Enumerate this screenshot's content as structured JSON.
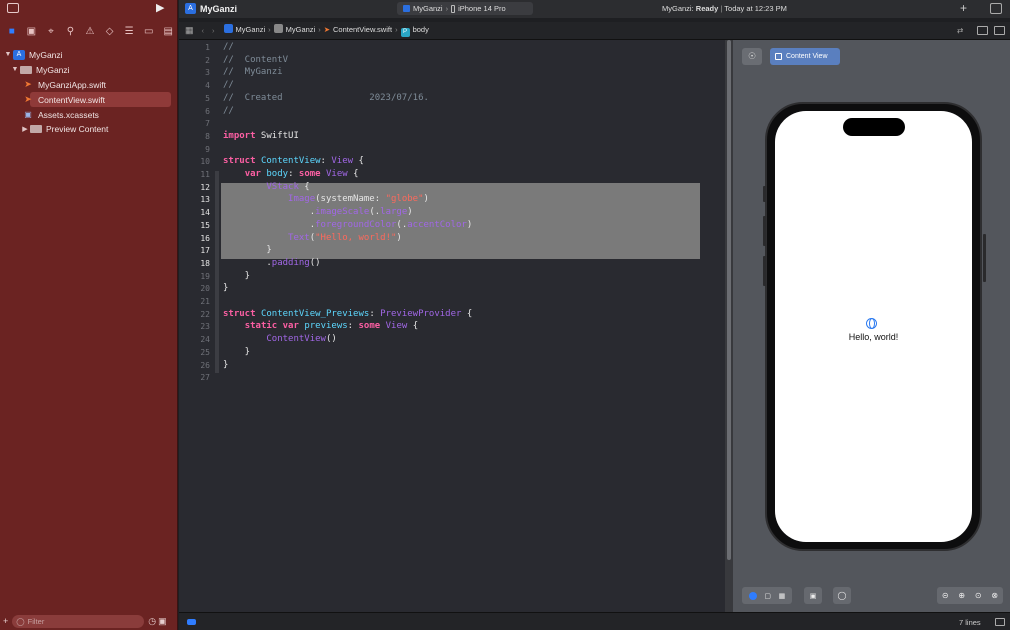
{
  "toolbar": {
    "project_title": "MyGanzi",
    "scheme_target": "MyGanzi",
    "scheme_device": "iPhone 14 Pro",
    "status_project": "MyGanzi:",
    "status_state": "Ready",
    "status_time": "Today at 12:23 PM",
    "plus": "+"
  },
  "sidebar": {
    "filter_placeholder": "Filter",
    "tree": [
      {
        "label": "MyGanzi",
        "kind": "app",
        "depth": 0,
        "open": true
      },
      {
        "label": "MyGanzi",
        "kind": "folder",
        "depth": 1,
        "open": true
      },
      {
        "label": "MyGanziApp.swift",
        "kind": "swift",
        "depth": 2
      },
      {
        "label": "ContentView.swift",
        "kind": "swift",
        "depth": 2,
        "selected": true
      },
      {
        "label": "Assets.xcassets",
        "kind": "assets",
        "depth": 2
      },
      {
        "label": "Preview Content",
        "kind": "folder",
        "depth": 2,
        "open": false
      }
    ]
  },
  "jumpbar": {
    "crumbs": [
      "MyGanzi",
      "MyGanzi",
      "ContentView.swift",
      "body"
    ]
  },
  "editor": {
    "lines": [
      [
        [
          "cm",
          "//"
        ]
      ],
      [
        [
          "cm",
          "//  ContentV"
        ]
      ],
      [
        [
          "cm",
          "//  MyGanzi"
        ]
      ],
      [
        [
          "cm",
          "//"
        ]
      ],
      [
        [
          "cm",
          "//  Created                2023/07/16."
        ]
      ],
      [
        [
          "cm",
          "//"
        ]
      ],
      [],
      [
        [
          "kw",
          "import"
        ],
        [
          "pl",
          " SwiftUI"
        ]
      ],
      [],
      [
        [
          "kw",
          "struct"
        ],
        [
          "pl",
          " "
        ],
        [
          "ty",
          "ContentView"
        ],
        [
          "pl",
          ": "
        ],
        [
          "fn",
          "View"
        ],
        [
          "pl",
          " {"
        ]
      ],
      [
        [
          "pl",
          "    "
        ],
        [
          "kw",
          "var"
        ],
        [
          "pl",
          " "
        ],
        [
          "ty",
          "body"
        ],
        [
          "pl",
          ": "
        ],
        [
          "kw",
          "some"
        ],
        [
          "pl",
          " "
        ],
        [
          "fn",
          "View"
        ],
        [
          "pl",
          " {"
        ]
      ],
      [
        [
          "pl",
          "        "
        ],
        [
          "fn",
          "VStack"
        ],
        [
          "pl",
          " {"
        ]
      ],
      [
        [
          "pl",
          "            "
        ],
        [
          "fn",
          "Image"
        ],
        [
          "pl",
          "(systemName: "
        ],
        [
          "st",
          "\"globe\""
        ],
        [
          "pl",
          ")"
        ]
      ],
      [
        [
          "pl",
          "                ."
        ],
        [
          "fn",
          "imageScale"
        ],
        [
          "pl",
          "(."
        ],
        [
          "fn",
          "large"
        ],
        [
          "pl",
          ")"
        ]
      ],
      [
        [
          "pl",
          "                ."
        ],
        [
          "fn",
          "foregroundColor"
        ],
        [
          "pl",
          "(."
        ],
        [
          "fn",
          "accentColor"
        ],
        [
          "pl",
          ")"
        ]
      ],
      [
        [
          "pl",
          "            "
        ],
        [
          "fn",
          "Text"
        ],
        [
          "pl",
          "("
        ],
        [
          "st",
          "\"Hello, world!\""
        ],
        [
          "pl",
          ")"
        ]
      ],
      [
        [
          "pl",
          "        }"
        ]
      ],
      [
        [
          "pl",
          "        ."
        ],
        [
          "fn",
          "padding"
        ],
        [
          "pl",
          "()"
        ]
      ],
      [
        [
          "pl",
          "    }"
        ]
      ],
      [
        [
          "pl",
          "}"
        ]
      ],
      [],
      [
        [
          "kw",
          "struct"
        ],
        [
          "pl",
          " "
        ],
        [
          "ty",
          "ContentView_Previews"
        ],
        [
          "pl",
          ": "
        ],
        [
          "fn",
          "PreviewProvider"
        ],
        [
          "pl",
          " {"
        ]
      ],
      [
        [
          "pl",
          "    "
        ],
        [
          "kw",
          "static"
        ],
        [
          "pl",
          " "
        ],
        [
          "kw",
          "var"
        ],
        [
          "pl",
          " "
        ],
        [
          "ty",
          "previews"
        ],
        [
          "pl",
          ": "
        ],
        [
          "kw",
          "some"
        ],
        [
          "pl",
          " "
        ],
        [
          "fn",
          "View"
        ],
        [
          "pl",
          " {"
        ]
      ],
      [
        [
          "pl",
          "        "
        ],
        [
          "fn",
          "ContentView"
        ],
        [
          "pl",
          "()"
        ]
      ],
      [
        [
          "pl",
          "    }"
        ]
      ],
      [
        [
          "pl",
          "}"
        ]
      ],
      []
    ]
  },
  "canvas": {
    "preview_label": "Content View",
    "preview_text": "Hello, world!"
  },
  "statusbar": {
    "line_count": "7 lines"
  },
  "colors": {
    "sidebar_bg": "#6b2322",
    "accent": "#2f7dff",
    "selection": "#7a7a7a"
  }
}
